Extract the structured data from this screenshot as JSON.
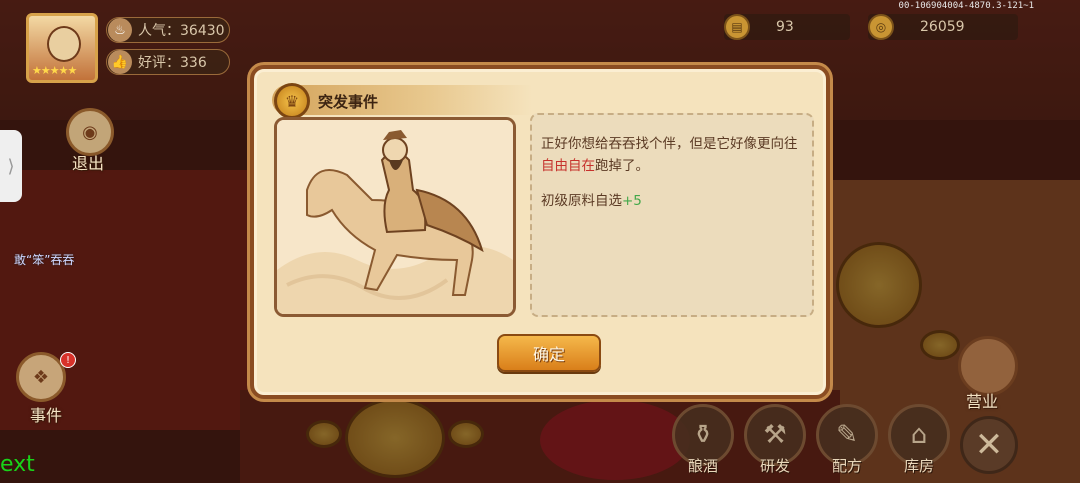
{
  "hud": {
    "popularity_label": "人气：36430",
    "rating_label": "好评：336",
    "avatar_stars": "★★★★★",
    "resource_a": "93",
    "resource_b": "26059",
    "build_id": "00-106904004-4870.3-121~1"
  },
  "left": {
    "side_tab_glyph": "⟩",
    "exit_label": "退出",
    "event_label": "事件",
    "event_badge": "!",
    "npc_name": "敢“笨”吞吞",
    "ext_text": "ext"
  },
  "dialog": {
    "title": "突发事件",
    "desc_part1": "正好你想给吞吞找个伴，但是它好像更向往",
    "desc_highlight": "自由自在",
    "desc_part2": "跑掉了。",
    "reward_name": "初级原料自选",
    "reward_amount": "+5",
    "confirm_label": "确定"
  },
  "menu": {
    "items": [
      {
        "label": "酿酒",
        "icon": "wine-icon"
      },
      {
        "label": "研发",
        "icon": "research-icon"
      },
      {
        "label": "配方",
        "icon": "recipe-icon"
      },
      {
        "label": "库房",
        "icon": "warehouse-icon"
      }
    ],
    "business_label": "营业",
    "close_glyph": "✕"
  },
  "colors": {
    "dialog_bg": "#f5e3bd",
    "highlight_red": "#c6322c",
    "reward_green": "#44a84a",
    "button_orange": "#e99a2e"
  }
}
